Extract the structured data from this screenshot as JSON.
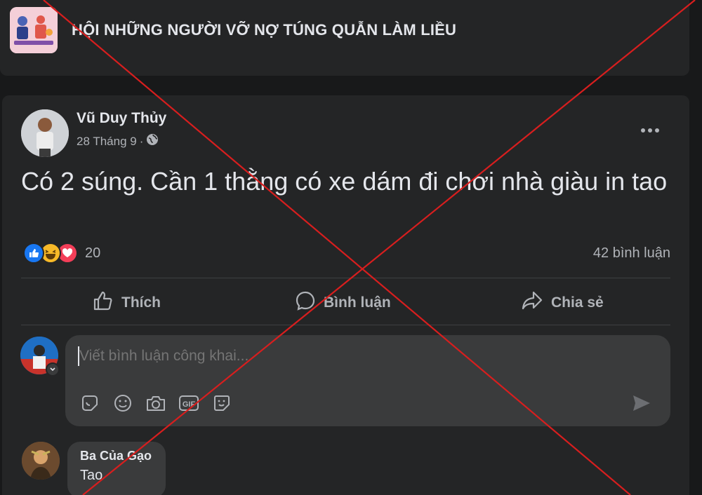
{
  "group": {
    "name": "HỘI NHỮNG NGƯỜI VỠ NỢ TÚNG QUẪN LÀM LIỀU"
  },
  "post": {
    "author": "Vũ Duy Thủy",
    "date": "28 Tháng 9",
    "separator": "·",
    "privacy_icon": "globe-icon",
    "text": "Có 2 súng. Cần 1 thằng có xe dám đi chơi nhà giàu in tao",
    "reaction_count": "20",
    "reaction_icons": [
      "like-icon",
      "haha-icon",
      "love-icon"
    ],
    "comment_count": "42 bình luận"
  },
  "actions": {
    "like": "Thích",
    "comment": "Bình luận",
    "share": "Chia sẻ"
  },
  "composer": {
    "placeholder": "Viết bình luận công khai...",
    "tools": [
      "sticker-icon",
      "emoji-icon",
      "camera-icon",
      "gif-icon",
      "sticker-face-icon"
    ],
    "gif_label": "GIF"
  },
  "comments": [
    {
      "author": "Ba Của Gạo",
      "text": "Tao"
    }
  ],
  "colors": {
    "background": "#18191a",
    "card": "#242526",
    "input": "#3a3b3c",
    "text": "#e4e6eb",
    "muted": "#b0b3b8",
    "overlay_cross": "#d81e1e",
    "like_blue": "#1877f2",
    "love_red": "#f33e58",
    "haha_yellow": "#f7b928"
  }
}
